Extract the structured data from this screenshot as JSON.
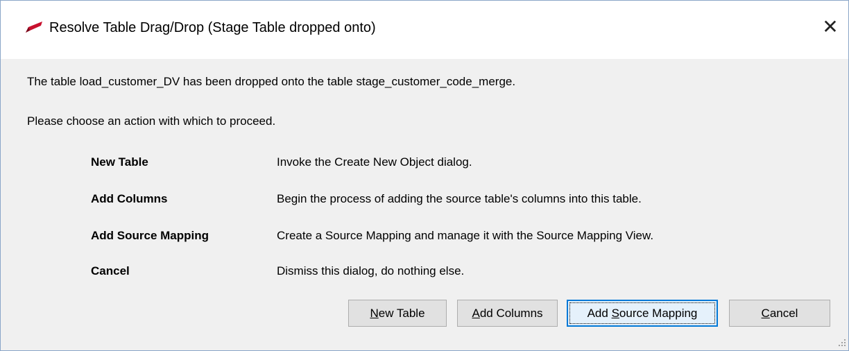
{
  "window": {
    "title": "Resolve Table Drag/Drop (Stage Table dropped onto)",
    "icon": "red-pencil-icon",
    "close_glyph": "✕"
  },
  "message": {
    "line1": "The table load_customer_DV has been dropped onto the table stage_customer_code_merge.",
    "line2": "Please choose an action with which to proceed."
  },
  "options": [
    {
      "label": "New Table",
      "description": "Invoke the Create New Object dialog."
    },
    {
      "label": "Add Columns",
      "description": "Begin the process of adding the source table's columns into this table."
    },
    {
      "label": "Add Source Mapping",
      "description": "Create a Source Mapping and manage it with the Source Mapping View."
    },
    {
      "label": "Cancel",
      "description": "Dismiss this dialog, do nothing else."
    }
  ],
  "buttons": {
    "new_table": {
      "mnemonic": "N",
      "rest": "ew Table"
    },
    "add_columns": {
      "mnemonic": "A",
      "rest": "dd Columns"
    },
    "add_source_mapping": {
      "before": "Add ",
      "mnemonic": "S",
      "rest": "ource Mapping"
    },
    "cancel": {
      "mnemonic": "C",
      "rest": "ancel"
    }
  },
  "colors": {
    "accent": "#0078d7",
    "icon_red": "#c8102e"
  }
}
